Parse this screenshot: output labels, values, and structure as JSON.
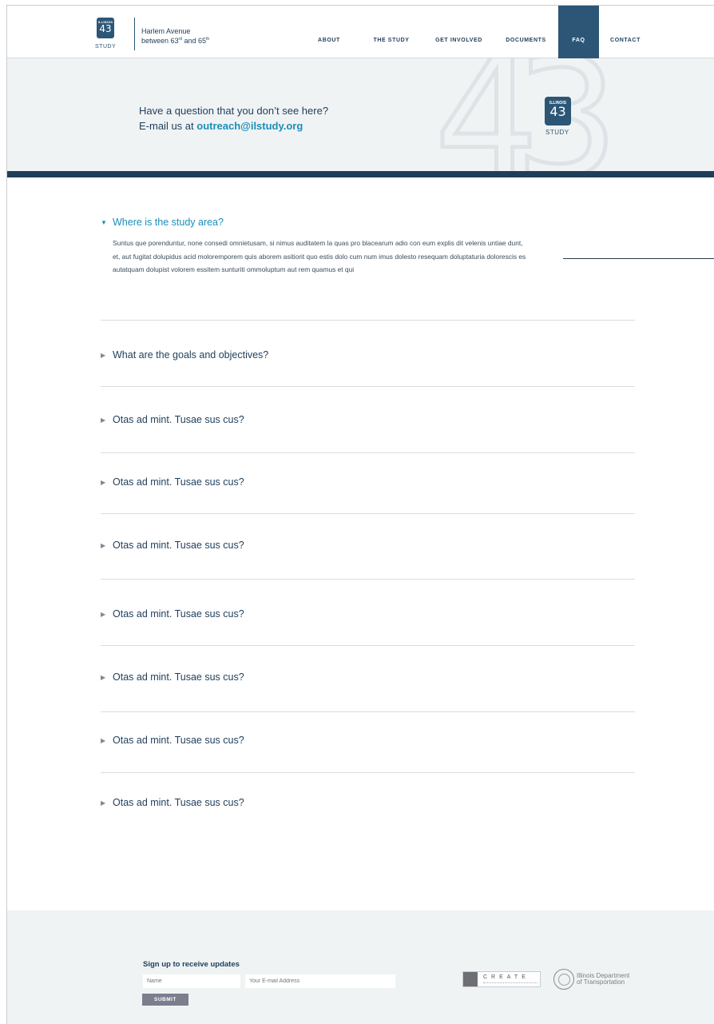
{
  "header": {
    "logo": {
      "state": "ILLINOIS",
      "number": "43",
      "word": "STUDY"
    },
    "tagline_line1": "Harlem Avenue",
    "tagline_line2_pre": "between 63",
    "tagline_sup1": "rd",
    "tagline_mid": " and 65",
    "tagline_sup2": "th",
    "nav": [
      {
        "label": "ABOUT",
        "active": false
      },
      {
        "label": "THE STUDY",
        "active": false
      },
      {
        "label": "GET INVOLVED",
        "active": false
      },
      {
        "label": "DOCUMENTS",
        "active": false
      },
      {
        "label": "FAQ",
        "active": true
      },
      {
        "label": "CONTACT",
        "active": false
      }
    ]
  },
  "hero": {
    "big_number": "43",
    "line1": "Have a question that you don’t see here?",
    "line2_pre": "E-mail us at ",
    "email": "outreach@ilstudy.org",
    "logo": {
      "state": "ILLINOIS",
      "number": "43",
      "word": "STUDY"
    }
  },
  "faq": [
    {
      "question": "Where is the study area?",
      "open": true,
      "answer": "Suntus que porenduntur, none consedi omnietusam, si nimus auditatem la quas pro blacearum adio con eum explis dit velenis untiae dunt, et, aut fugitat dolupidus acid moloremporem quis aborem asitiorit quo estis dolo cum num imus dolesto resequam doluptaturia dolorescis es autatquam dolupist volorem essitem sunturiti ommoluptum aut rem quamus et qui"
    },
    {
      "question": "What are the goals and objectives?",
      "open": false
    },
    {
      "question": "Otas ad mint. Tusae sus cus?",
      "open": false
    },
    {
      "question": "Otas ad mint. Tusae sus cus?",
      "open": false
    },
    {
      "question": "Otas ad mint. Tusae sus cus?",
      "open": false
    },
    {
      "question": "Otas ad mint. Tusae sus cus?",
      "open": false
    },
    {
      "question": "Otas ad mint. Tusae sus cus?",
      "open": false
    },
    {
      "question": "Otas ad mint. Tusae sus cus?",
      "open": false
    },
    {
      "question": "Otas ad mint. Tusae sus cus?",
      "open": false
    }
  ],
  "icons": {
    "expanded": "triangle-down-icon",
    "collapsed": "triangle-right-icon"
  },
  "footer": {
    "signup_title": "Sign up to receive updates",
    "name_placeholder": "Name",
    "email_placeholder": "Your E-mail Address",
    "submit_label": "SUBMIT",
    "create_logo_text": "CREATE",
    "idot_line1": "Illinois Department",
    "idot_line2": "of Transportation"
  },
  "colors": {
    "navy": "#1f3e5a",
    "active_nav": "#2d5676",
    "link_blue": "#1a8fb8",
    "hero_bg": "#f0f3f4",
    "submit_bg": "#7c7d8d"
  }
}
